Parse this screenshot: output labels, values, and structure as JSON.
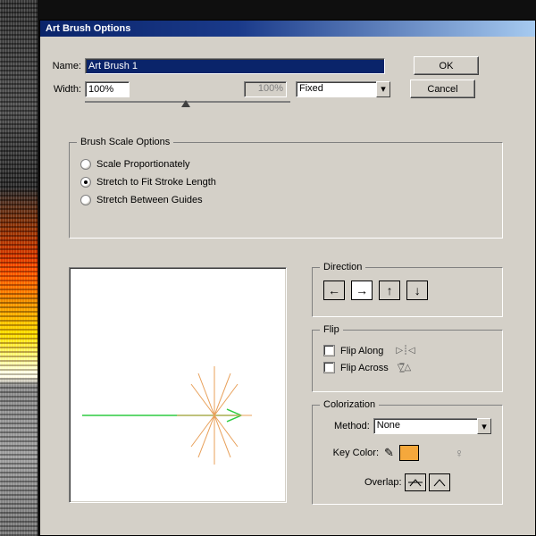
{
  "dialog": {
    "title": "Art Brush Options",
    "name_label": "Name:",
    "name_value": "Art Brush 1",
    "width_label": "Width:",
    "width_value": "100%",
    "width_readonly": "100%",
    "width_mode": "Fixed",
    "ok": "OK",
    "cancel": "Cancel"
  },
  "scale": {
    "legend": "Brush Scale Options",
    "opt1": "Scale Proportionately",
    "opt2": "Stretch to Fit Stroke Length",
    "opt3": "Stretch Between Guides",
    "selected": 2
  },
  "direction": {
    "legend": "Direction"
  },
  "flip": {
    "legend": "Flip",
    "along": "Flip Along",
    "across": "Flip Across"
  },
  "colorization": {
    "legend": "Colorization",
    "method_label": "Method:",
    "method_value": "None",
    "key_label": "Key Color:",
    "overlap_label": "Overlap:"
  }
}
